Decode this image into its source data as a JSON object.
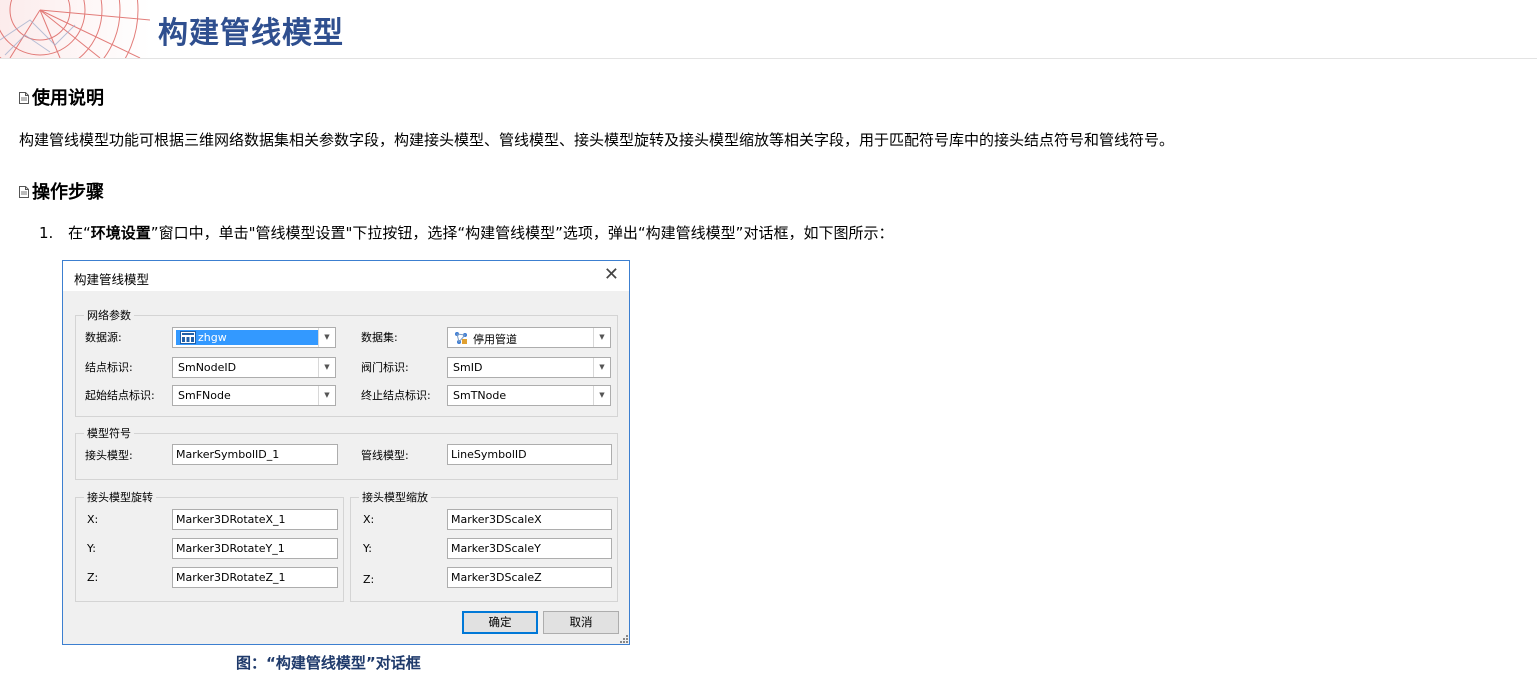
{
  "header": {
    "title": "构建管线模型"
  },
  "sections": {
    "usage_title": "使用说明",
    "usage_text": "构建管线模型功能可根据三维网络数据集相关参数字段，构建接头模型、管线模型、接头模型旋转及接头模型缩放等相关字段，用于匹配符号库中的接头结点符号和管线符号。",
    "steps_title": "操作步骤"
  },
  "step1": {
    "number": "1.",
    "pre": "在“",
    "bold": "环境设置",
    "post": "”窗口中，单击\"管线模型设置\"下拉按钮，选择“构建管线模型”选项，弹出“构建管线模型”对话框，如下图所示："
  },
  "dialog": {
    "title": "构建管线模型",
    "close_glyph": "✕",
    "network": {
      "legend": "网络参数",
      "datasource_label": "数据源:",
      "datasource_value": "zhgw",
      "dataset_label": "数据集:",
      "dataset_value": "停用管道",
      "node_id_label": "结点标识:",
      "node_id_value": "SmNodeID",
      "valve_id_label": "阀门标识:",
      "valve_id_value": "SmID",
      "fnode_label": "起始结点标识:",
      "fnode_value": "SmFNode",
      "tnode_label": "终止结点标识:",
      "tnode_value": "SmTNode"
    },
    "symbol": {
      "legend": "模型符号",
      "joint_label": "接头模型:",
      "joint_value": "MarkerSymbolID_1",
      "pipe_label": "管线模型:",
      "pipe_value": "LineSymbolID"
    },
    "rotate": {
      "legend": "接头模型旋转",
      "x_label": "X:",
      "x_value": "Marker3DRotateX_1",
      "y_label": "Y:",
      "y_value": "Marker3DRotateY_1",
      "z_label": "Z:",
      "z_value": "Marker3DRotateZ_1"
    },
    "scale": {
      "legend": "接头模型缩放",
      "x_label": "X:",
      "x_value": "Marker3DScaleX",
      "y_label": "Y:",
      "y_value": "Marker3DScaleY",
      "z_label": "Z:",
      "z_value": "Marker3DScaleZ"
    },
    "ok_label": "确定",
    "cancel_label": "取消"
  },
  "caption": "图：“构建管线模型”对话框",
  "colors": {
    "title": "#2f4f8f",
    "caption": "#1f3a6b",
    "dialog_border": "#3c7fd0",
    "selection": "#3399ff"
  }
}
